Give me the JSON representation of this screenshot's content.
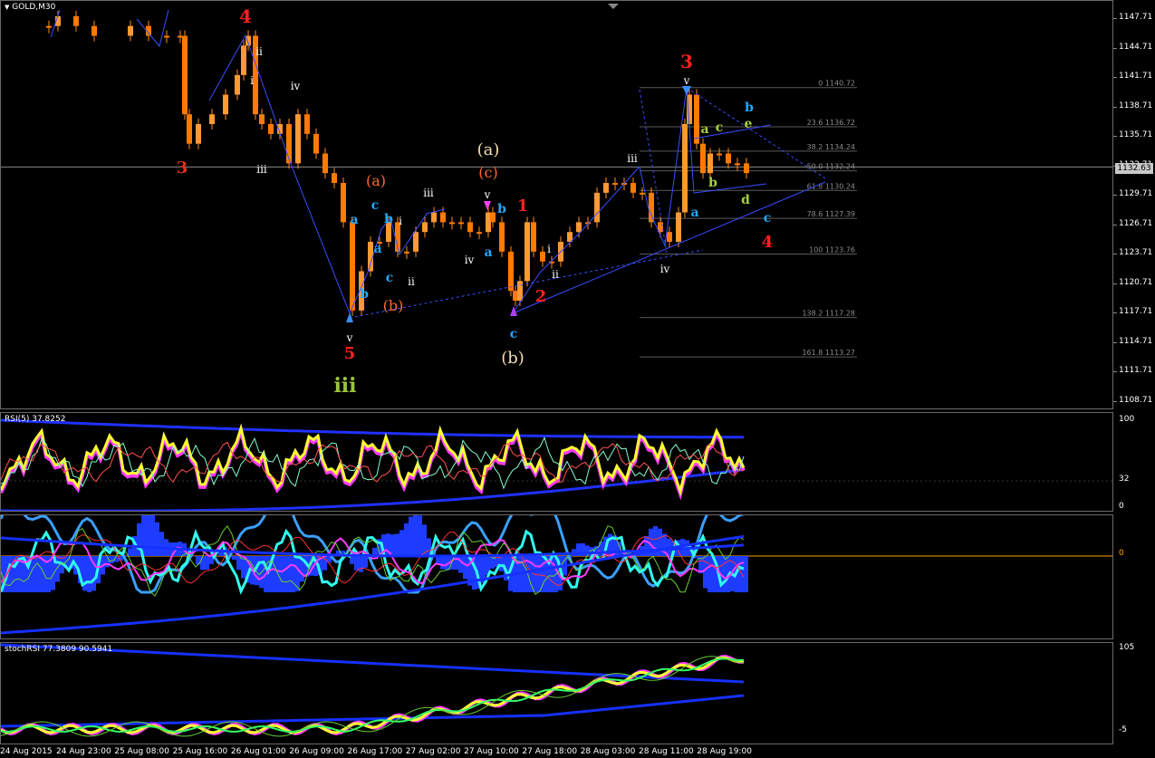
{
  "main": {
    "title": "GOLD,M30",
    "price_axis": [
      "1147.71",
      "1144.71",
      "1141.71",
      "1138.71",
      "1135.71",
      "1132.71",
      "1129.71",
      "1126.71",
      "1123.71",
      "1120.71",
      "1117.71",
      "1114.71",
      "1111.71",
      "1108.71"
    ],
    "current_price": "1132.63",
    "fib_levels": [
      "0 1140.72",
      "23.6 1136.72",
      "38.2 1134.24",
      "50.0 1132.24",
      "61.8 1130.24",
      "78.6 1127.39",
      "100 1123.76",
      "138.2 1117.28",
      "161.8 1113.27"
    ],
    "labels": {
      "w4_top": "4",
      "w3_left": "3",
      "w5": "5",
      "iii_green": "iii",
      "a_paren": "(a)",
      "c_paren": "(c)",
      "b_paren": "(b)",
      "a_orange": "(a)",
      "b_orange": "(b)",
      "w1": "1",
      "w2": "2",
      "w3_top": "3",
      "w4_right": "4",
      "roman_ii": "ii",
      "roman_i": "i",
      "roman_iii": "iii",
      "roman_iv": "iv",
      "roman_v": "v",
      "a": "a",
      "b": "b",
      "c": "c",
      "d": "d",
      "e": "e"
    },
    "colors": {
      "candle_up": "#ff9933",
      "candle_dn": "#ff7a00",
      "trend": "#3a4dff",
      "red": "#ff2020",
      "cyan": "#22aaff",
      "olive": "#a6d23c"
    }
  },
  "rsi": {
    "label": "RSI(5) 37.8252",
    "axis": [
      "100",
      "32",
      "0"
    ]
  },
  "osc": {
    "axis": [
      "0"
    ]
  },
  "stoch": {
    "label": "stochRSI 77.3809 90.5941",
    "axis": [
      "105",
      "-5"
    ]
  },
  "time_axis": [
    "24 Aug 2015",
    "24 Aug 23:00",
    "25 Aug 08:00",
    "25 Aug 16:00",
    "26 Aug 01:00",
    "26 Aug 09:00",
    "26 Aug 17:00",
    "27 Aug 02:00",
    "27 Aug 10:00",
    "27 Aug 18:00",
    "28 Aug 03:00",
    "28 Aug 11:00",
    "28 Aug 19:00"
  ]
}
